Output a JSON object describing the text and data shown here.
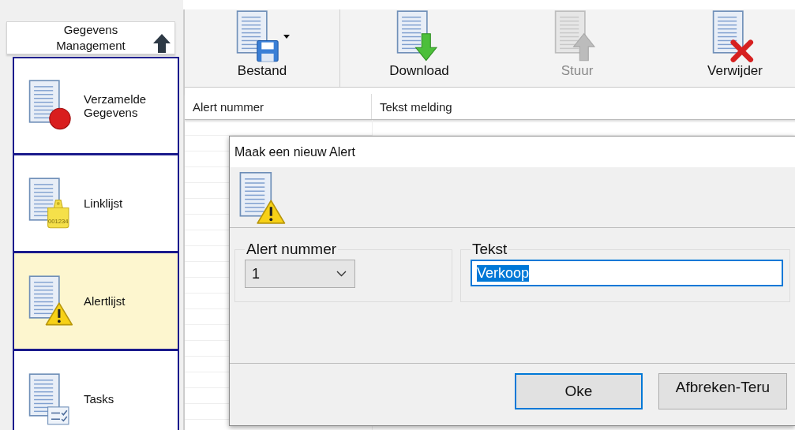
{
  "sidebar": {
    "header": "Gegevens Management",
    "items": [
      {
        "label": "Verzamelde Gegevens",
        "kind": "record",
        "selected": false
      },
      {
        "label": "Linklijst",
        "kind": "tag",
        "tag_label": "001234",
        "selected": false
      },
      {
        "label": "Alertlijst",
        "kind": "alert",
        "selected": true
      },
      {
        "label": "Tasks",
        "kind": "tasks",
        "selected": false
      }
    ]
  },
  "toolbar": [
    {
      "label": "Bestand",
      "kind": "save",
      "dropdown": true,
      "disabled": false
    },
    {
      "label": "Download",
      "kind": "download",
      "dropdown": false,
      "disabled": false
    },
    {
      "label": "Stuur",
      "kind": "send",
      "dropdown": false,
      "disabled": true
    },
    {
      "label": "Verwijder",
      "kind": "delete",
      "dropdown": false,
      "disabled": false
    }
  ],
  "table": {
    "columns": [
      "Alert nummer",
      "Tekst melding"
    ]
  },
  "dialog": {
    "title": "Maak een nieuw Alert",
    "alert_number": {
      "label": "Alert nummer",
      "value": "1"
    },
    "text": {
      "label": "Tekst",
      "value": "Verkoop",
      "selected": true
    },
    "buttons": [
      {
        "label": "Oke",
        "default": true
      },
      {
        "label": "Afbreken-Teru",
        "default": false
      }
    ]
  }
}
